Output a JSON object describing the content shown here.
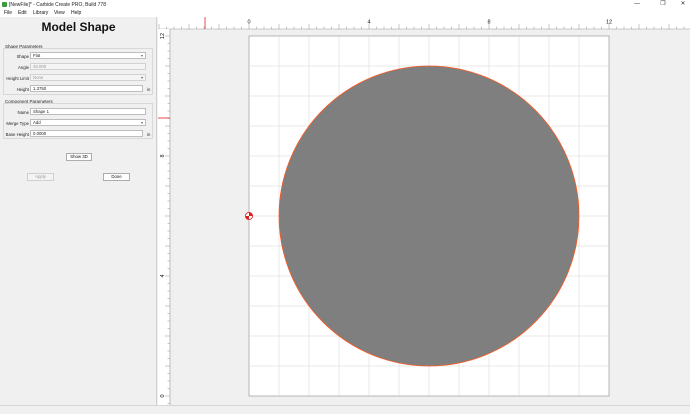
{
  "window": {
    "title": "[NewFile]* - Carbide Create PRO, Build 778",
    "controls": {
      "minimize": "—",
      "maximize": "❐",
      "close": "✕"
    }
  },
  "menu": {
    "items": [
      "File",
      "Edit",
      "Library",
      "View",
      "Help"
    ]
  },
  "panel": {
    "title": "Model Shape",
    "shape_parameters": {
      "label": "Shape Parameters",
      "shape_label": "Shape",
      "shape_value": "Flat",
      "angle_label": "Angle",
      "angle_value": "45.000",
      "height_limit_label": "Height Limit",
      "height_limit_value": "None",
      "height_label": "Height",
      "height_value": "1.3750",
      "height_unit": "in"
    },
    "component_parameters": {
      "label": "Component Parameters",
      "name_label": "Name",
      "name_value": "Shape 1",
      "merge_type_label": "Merge Type",
      "merge_type_value": "Add",
      "base_height_label": "Base Height",
      "base_height_value": "0.0000",
      "base_height_unit": "in"
    },
    "buttons": {
      "show_3d": "Show 3D",
      "apply": "Apply",
      "done": "Done"
    }
  },
  "canvas": {
    "ruler_top_labels": [
      "0",
      "4",
      "8",
      "12"
    ],
    "ruler_left_labels": [
      "12",
      "8",
      "4",
      "0"
    ],
    "colors": {
      "shape_fill": "#7f7f7f",
      "shape_outline": "#ff5a1f",
      "grid": "#d4d4d4",
      "origin_marker": "#e02020"
    }
  }
}
